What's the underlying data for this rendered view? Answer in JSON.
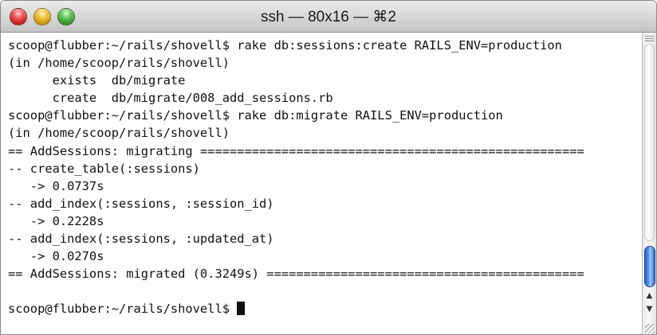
{
  "window": {
    "title": "ssh — 80x16 — ⌘2"
  },
  "terminal": {
    "lines": [
      "scoop@flubber:~/rails/shovell$ rake db:sessions:create RAILS_ENV=production",
      "(in /home/scoop/rails/shovell)",
      "      exists  db/migrate",
      "      create  db/migrate/008_add_sessions.rb",
      "scoop@flubber:~/rails/shovell$ rake db:migrate RAILS_ENV=production",
      "(in /home/scoop/rails/shovell)",
      "== AddSessions: migrating ====================================================",
      "-- create_table(:sessions)",
      "   -> 0.0737s",
      "-- add_index(:sessions, :session_id)",
      "   -> 0.2228s",
      "-- add_index(:sessions, :updated_at)",
      "   -> 0.0270s",
      "== AddSessions: migrated (0.3249s) ===========================================",
      "",
      "scoop@flubber:~/rails/shovell$ "
    ]
  },
  "icons": {
    "close": "close-button-icon",
    "minimize": "minimize-button-icon",
    "zoom": "zoom-button-icon",
    "scroll_up": "scroll-up-arrow-icon",
    "scroll_down": "scroll-down-arrow-icon",
    "resize": "resize-grip-icon"
  },
  "colors": {
    "close": "#e0443e",
    "minimize": "#dea123",
    "zoom": "#1aab29",
    "scroll_thumb": "#3f7fdc"
  }
}
